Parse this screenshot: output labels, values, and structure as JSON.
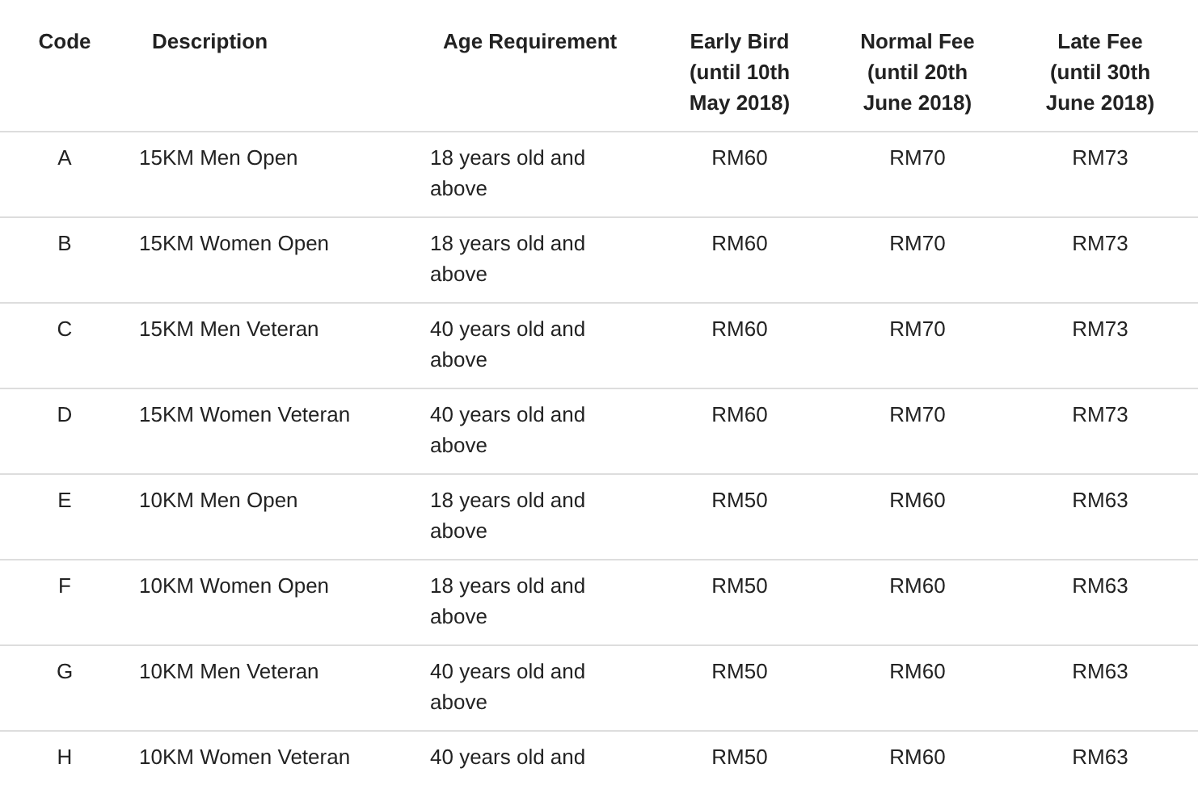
{
  "table": {
    "columns": [
      {
        "label": "Code"
      },
      {
        "label": "Description"
      },
      {
        "label": "Age Requirement"
      },
      {
        "label": "Early Bird",
        "note": "(until 10th May 2018)"
      },
      {
        "label": "Normal Fee",
        "note": "(until 20th June 2018)"
      },
      {
        "label": "Late Fee",
        "note": "(until 30th June 2018)"
      }
    ],
    "rows": [
      [
        "A",
        "15KM Men Open",
        "18 years old and above",
        "RM60",
        "RM70",
        "RM73"
      ],
      [
        "B",
        "15KM Women Open",
        "18 years old and above",
        "RM60",
        "RM70",
        "RM73"
      ],
      [
        "C",
        "15KM Men Veteran",
        "40 years old and above",
        "RM60",
        "RM70",
        "RM73"
      ],
      [
        "D",
        "15KM Women Veteran",
        "40 years old and above",
        "RM60",
        "RM70",
        "RM73"
      ],
      [
        "E",
        "10KM Men Open",
        "18 years old and above",
        "RM50",
        "RM60",
        "RM63"
      ],
      [
        "F",
        "10KM Women Open",
        "18 years old and above",
        "RM50",
        "RM60",
        "RM63"
      ],
      [
        "G",
        "10KM Men Veteran",
        "40 years old and above",
        "RM50",
        "RM60",
        "RM63"
      ],
      [
        "H",
        "10KM Women Veteran",
        "40 years old and",
        "RM50",
        "RM60",
        "RM63"
      ]
    ]
  }
}
